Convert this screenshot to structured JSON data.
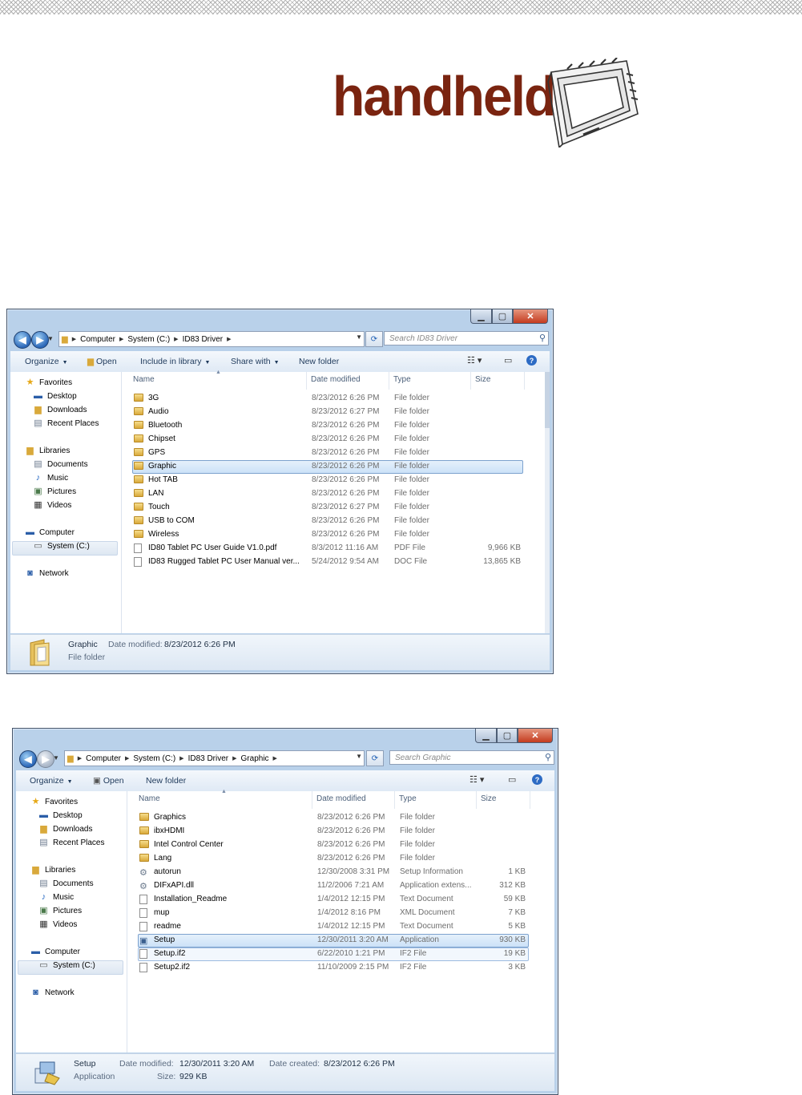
{
  "logo": {
    "text": "handheld"
  },
  "window1": {
    "address": [
      "Computer",
      "System (C:)",
      "ID83 Driver"
    ],
    "search_placeholder": "Search ID83 Driver",
    "toolbar": {
      "organize": "Organize",
      "open": "Open",
      "include": "Include in library",
      "share": "Share with",
      "new_folder": "New folder"
    },
    "nav": {
      "favorites": "Favorites",
      "desktop": "Desktop",
      "downloads": "Downloads",
      "recent": "Recent Places",
      "libraries": "Libraries",
      "documents": "Documents",
      "music": "Music",
      "pictures": "Pictures",
      "videos": "Videos",
      "computer": "Computer",
      "system": "System (C:)",
      "network": "Network"
    },
    "columns": {
      "name": "Name",
      "date": "Date modified",
      "type": "Type",
      "size": "Size"
    },
    "rows": [
      {
        "name": "3G",
        "date": "8/23/2012 6:26 PM",
        "type": "File folder",
        "size": ""
      },
      {
        "name": "Audio",
        "date": "8/23/2012 6:27 PM",
        "type": "File folder",
        "size": ""
      },
      {
        "name": "Bluetooth",
        "date": "8/23/2012 6:26 PM",
        "type": "File folder",
        "size": ""
      },
      {
        "name": "Chipset",
        "date": "8/23/2012 6:26 PM",
        "type": "File folder",
        "size": ""
      },
      {
        "name": "GPS",
        "date": "8/23/2012 6:26 PM",
        "type": "File folder",
        "size": ""
      },
      {
        "name": "Graphic",
        "date": "8/23/2012 6:26 PM",
        "type": "File folder",
        "size": ""
      },
      {
        "name": "Hot TAB",
        "date": "8/23/2012 6:26 PM",
        "type": "File folder",
        "size": ""
      },
      {
        "name": "LAN",
        "date": "8/23/2012 6:26 PM",
        "type": "File folder",
        "size": ""
      },
      {
        "name": "Touch",
        "date": "8/23/2012 6:27 PM",
        "type": "File folder",
        "size": ""
      },
      {
        "name": "USB to COM",
        "date": "8/23/2012 6:26 PM",
        "type": "File folder",
        "size": ""
      },
      {
        "name": "Wireless",
        "date": "8/23/2012 6:26 PM",
        "type": "File folder",
        "size": ""
      },
      {
        "name": "ID80 Tablet PC User Guide V1.0.pdf",
        "date": "8/3/2012 11:16 AM",
        "type": "PDF File",
        "size": "9,966 KB"
      },
      {
        "name": "ID83 Rugged Tablet PC  User Manual ver...",
        "date": "5/24/2012 9:54 AM",
        "type": "DOC File",
        "size": "13,865 KB"
      }
    ],
    "details": {
      "name": "Graphic",
      "modified_label": "Date modified:",
      "modified": "8/23/2012 6:26 PM",
      "kind": "File folder"
    }
  },
  "window2": {
    "address": [
      "Computer",
      "System (C:)",
      "ID83 Driver",
      "Graphic"
    ],
    "search_placeholder": "Search Graphic",
    "toolbar": {
      "organize": "Organize",
      "open": "Open",
      "new_folder": "New folder"
    },
    "nav": {
      "favorites": "Favorites",
      "desktop": "Desktop",
      "downloads": "Downloads",
      "recent": "Recent Places",
      "libraries": "Libraries",
      "documents": "Documents",
      "music": "Music",
      "pictures": "Pictures",
      "videos": "Videos",
      "computer": "Computer",
      "system": "System (C:)",
      "network": "Network"
    },
    "columns": {
      "name": "Name",
      "date": "Date modified",
      "type": "Type",
      "size": "Size"
    },
    "rows": [
      {
        "name": "Graphics",
        "date": "8/23/2012 6:26 PM",
        "type": "File folder",
        "size": ""
      },
      {
        "name": "ibxHDMI",
        "date": "8/23/2012 6:26 PM",
        "type": "File folder",
        "size": ""
      },
      {
        "name": "Intel Control Center",
        "date": "8/23/2012 6:26 PM",
        "type": "File folder",
        "size": ""
      },
      {
        "name": "Lang",
        "date": "8/23/2012 6:26 PM",
        "type": "File folder",
        "size": ""
      },
      {
        "name": "autorun",
        "date": "12/30/2008 3:31 PM",
        "type": "Setup Information",
        "size": "1 KB"
      },
      {
        "name": "DIFxAPI.dll",
        "date": "11/2/2006 7:21 AM",
        "type": "Application extens...",
        "size": "312 KB"
      },
      {
        "name": "Installation_Readme",
        "date": "1/4/2012 12:15 PM",
        "type": "Text Document",
        "size": "59 KB"
      },
      {
        "name": "mup",
        "date": "1/4/2012 8:16 PM",
        "type": "XML Document",
        "size": "7 KB"
      },
      {
        "name": "readme",
        "date": "1/4/2012 12:15 PM",
        "type": "Text Document",
        "size": "5 KB"
      },
      {
        "name": "Setup",
        "date": "12/30/2011 3:20 AM",
        "type": "Application",
        "size": "930 KB"
      },
      {
        "name": "Setup.if2",
        "date": "6/22/2010 1:21 PM",
        "type": "IF2 File",
        "size": "19 KB"
      },
      {
        "name": "Setup2.if2",
        "date": "11/10/2009 2:15 PM",
        "type": "IF2 File",
        "size": "3 KB"
      }
    ],
    "details": {
      "name": "Setup",
      "kind": "Application",
      "modified_label": "Date modified:",
      "modified": "12/30/2011 3:20 AM",
      "size_label": "Size:",
      "size": "929 KB",
      "created_label": "Date created:",
      "created": "8/23/2012 6:26 PM"
    }
  }
}
